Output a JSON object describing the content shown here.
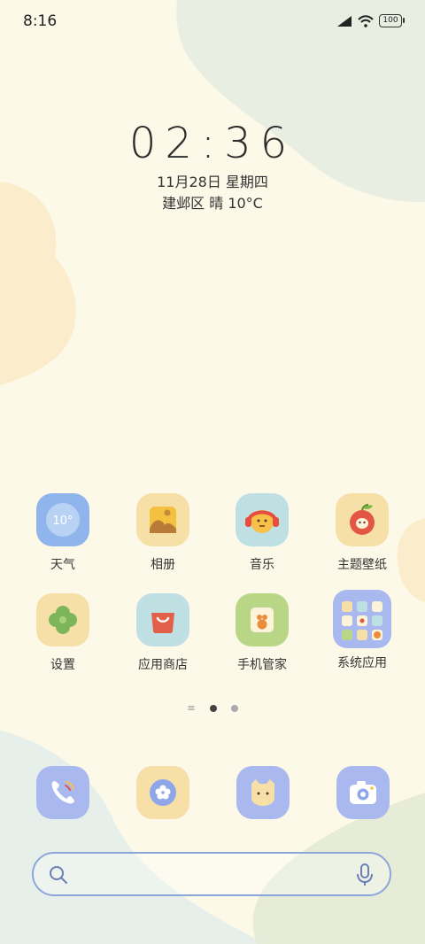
{
  "status_bar": {
    "time": "8:16",
    "battery": "100"
  },
  "clock": {
    "time": "02:36",
    "date": "11月28日 星期四",
    "weather": "建邺区 晴 10°C"
  },
  "apps": [
    {
      "label": "天气",
      "icon": "weather-icon",
      "icon_text": "10°"
    },
    {
      "label": "相册",
      "icon": "photo-icon"
    },
    {
      "label": "音乐",
      "icon": "music-icon"
    },
    {
      "label": "主题壁纸",
      "icon": "theme-icon"
    },
    {
      "label": "设置",
      "icon": "settings-icon"
    },
    {
      "label": "应用商店",
      "icon": "store-icon"
    },
    {
      "label": "手机管家",
      "icon": "phone-manager-icon"
    },
    {
      "label": "系统应用",
      "icon": "system-folder-icon"
    }
  ],
  "page_indicator": {
    "pages": 2,
    "current": 1
  },
  "dock": [
    "phone-icon",
    "flower-icon",
    "messages-icon",
    "camera-icon"
  ],
  "colors": {
    "background": "#fdf9e9",
    "blue": "#a9b9ef",
    "yellow": "#f7dfa8",
    "teal": "#bfe0e3",
    "green": "#b8d686"
  }
}
